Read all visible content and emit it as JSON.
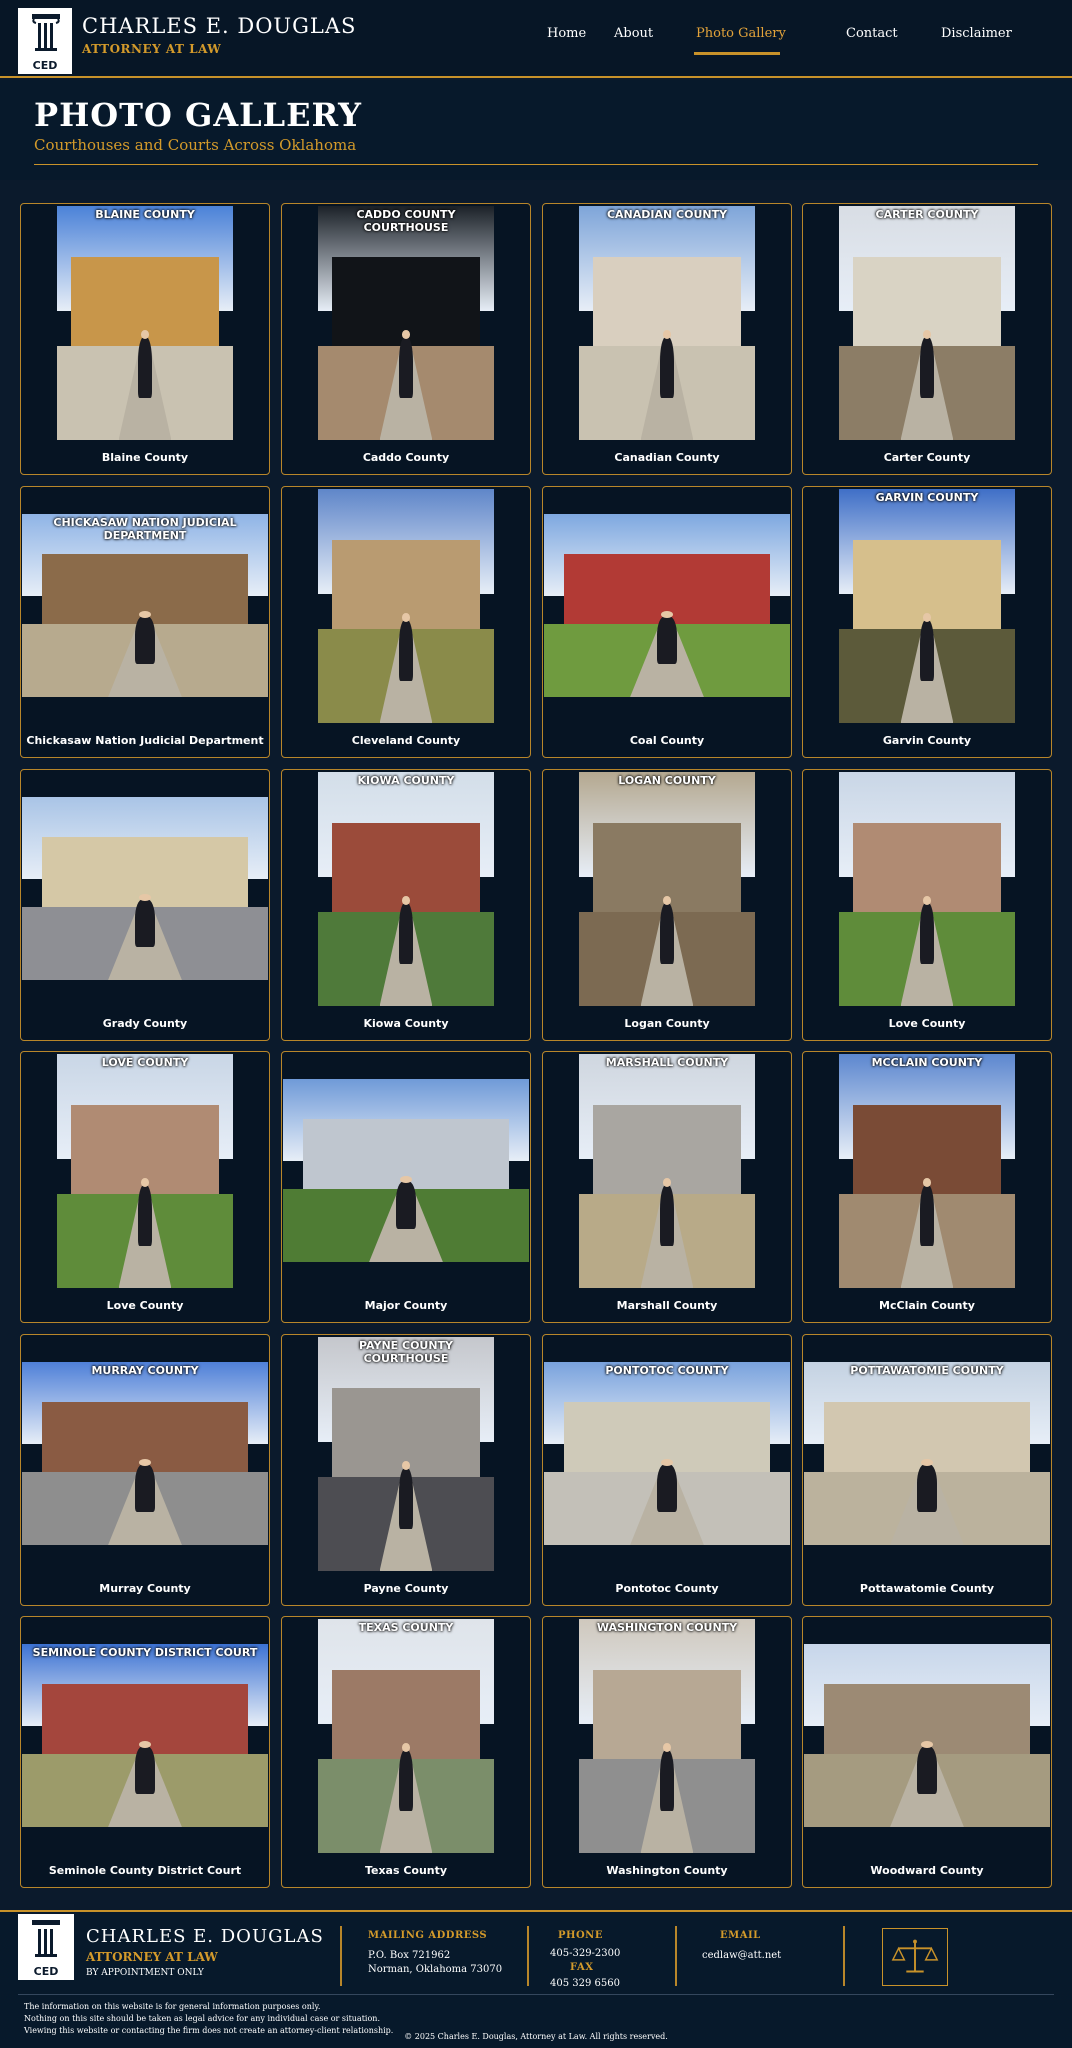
{
  "header": {
    "logo_text": "CED",
    "brand_name": "CHARLES E. DOUGLAS",
    "brand_sub": "ATTORNEY AT LAW",
    "nav": [
      {
        "label": "Home"
      },
      {
        "label": "About"
      },
      {
        "label": "Photo Gallery"
      },
      {
        "label": "Contact"
      },
      {
        "label": "Disclaimer"
      }
    ],
    "active_nav": "Photo Gallery"
  },
  "hero": {
    "title": "PHOTO GALLERY",
    "subtitle": "Courthouses and Courts Across Oklahoma"
  },
  "gallery": [
    {
      "caption": "Blaine County",
      "overlay": "BLAINE COUNTY"
    },
    {
      "caption": "Caddo County",
      "overlay": "CADDO COUNTY COURTHOUSE"
    },
    {
      "caption": "Canadian County",
      "overlay": "CANADIAN COUNTY"
    },
    {
      "caption": "Carter County",
      "overlay": "CARTER COUNTY"
    },
    {
      "caption": "Chickasaw Nation Judicial Department",
      "overlay": "CHICKASAW NATION JUDICIAL DEPARTMENT"
    },
    {
      "caption": "Cleveland County",
      "overlay": ""
    },
    {
      "caption": "Coal County",
      "overlay": ""
    },
    {
      "caption": "Garvin County",
      "overlay": "GARVIN COUNTY"
    },
    {
      "caption": "Grady County",
      "overlay": ""
    },
    {
      "caption": "Kiowa County",
      "overlay": "KIOWA COUNTY"
    },
    {
      "caption": "Logan County",
      "overlay": "LOGAN COUNTY"
    },
    {
      "caption": "Love County",
      "overlay": ""
    },
    {
      "caption": "Love County",
      "overlay": "LOVE COUNTY"
    },
    {
      "caption": "Major County",
      "overlay": ""
    },
    {
      "caption": "Marshall County",
      "overlay": "MARSHALL COUNTY"
    },
    {
      "caption": "McClain County",
      "overlay": "MCCLAIN COUNTY"
    },
    {
      "caption": "Murray County",
      "overlay": "MURRAY COUNTY"
    },
    {
      "caption": "Payne County",
      "overlay": "PAYNE COUNTY COURTHOUSE"
    },
    {
      "caption": "Pontotoc County",
      "overlay": "PONTOTOC COUNTY"
    },
    {
      "caption": "Pottawatomie County",
      "overlay": "POTTAWATOMIE COUNTY"
    },
    {
      "caption": "Seminole County District Court",
      "overlay": "SEMINOLE COUNTY DISTRICT COURT"
    },
    {
      "caption": "Texas County",
      "overlay": "TEXAS COUNTY"
    },
    {
      "caption": "Washington County",
      "overlay": "WASHINGTON COUNTY"
    },
    {
      "caption": "Woodward County",
      "overlay": ""
    }
  ],
  "footer": {
    "logo_text": "CED",
    "brand_name": "CHARLES E. DOUGLAS",
    "brand_sub": "ATTORNEY AT LAW",
    "appointment": "BY APPOINTMENT ONLY",
    "mailing_heading": "MAILING ADDRESS",
    "mailing_line1": "P.O. Box 721962",
    "mailing_line2": "Norman, Oklahoma 73070",
    "phone_heading": "PHONE",
    "phone": "405-329-2300",
    "fax_heading": "FAX",
    "fax": "405 329 6560",
    "email_heading": "EMAIL",
    "email": "cedlaw@att.net",
    "disclaimer_1": "The information on this website is for general information purposes only.",
    "disclaimer_2": "Nothing on this site should be taken as legal advice for any individual case or situation.",
    "disclaimer_3": "Viewing this website or contacting the firm does not create an attorney-client relationship.",
    "copyright": "© 2025 Charles E. Douglas, Attorney at Law. All rights reserved."
  },
  "colors": {
    "accent": "#c8922a",
    "background": "#0b1a2c"
  }
}
